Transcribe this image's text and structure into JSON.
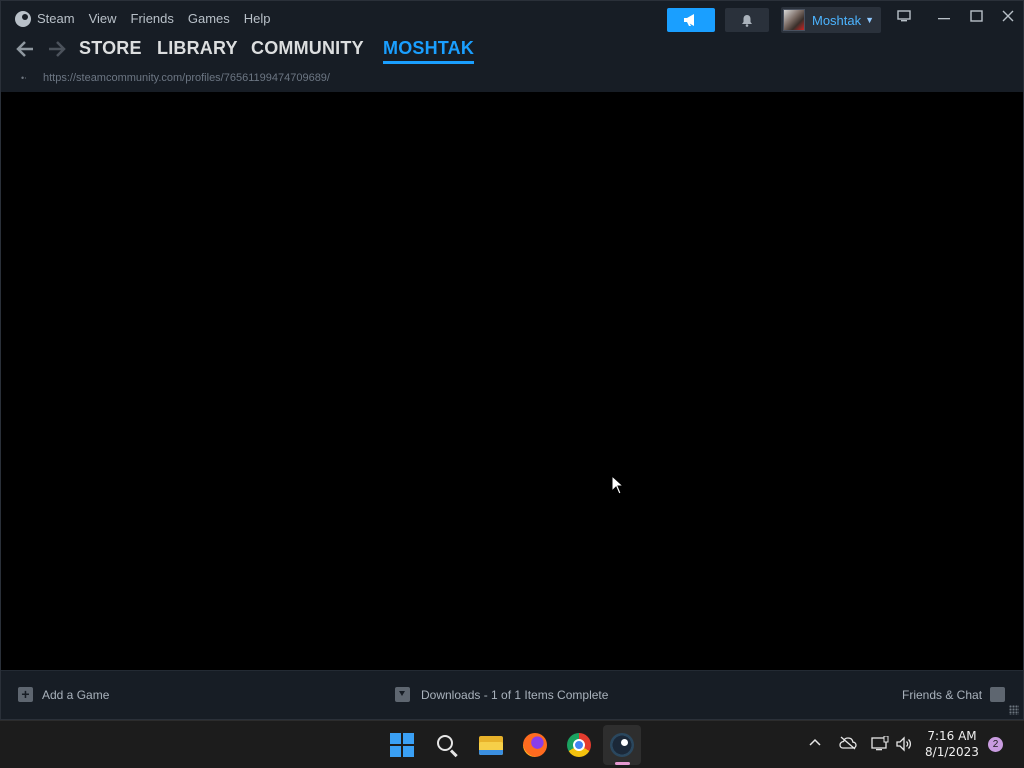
{
  "menu": {
    "steam": "Steam",
    "view": "View",
    "friends": "Friends",
    "games": "Games",
    "help": "Help"
  },
  "account": {
    "username": "Moshtak"
  },
  "nav": {
    "tabs": [
      {
        "label": "STORE"
      },
      {
        "label": "LIBRARY"
      },
      {
        "label": "COMMUNITY"
      },
      {
        "label": "MOSHTAK",
        "active": true
      }
    ]
  },
  "address": {
    "url": "https://steamcommunity.com/profiles/76561199474709689/"
  },
  "bottom_bar": {
    "add_game": "Add a Game",
    "downloads": "Downloads - 1 of 1 Items Complete",
    "friends_chat": "Friends & Chat"
  },
  "taskbar": {
    "pinned": [
      "start-button",
      "search",
      "file-explorer",
      "firefox",
      "chrome",
      "steam"
    ],
    "time": "7:16 AM",
    "date": "8/1/2023",
    "notifications": "2"
  },
  "colors": {
    "accent": "#1a9fff",
    "background": "#171d25",
    "content": "#000000"
  }
}
